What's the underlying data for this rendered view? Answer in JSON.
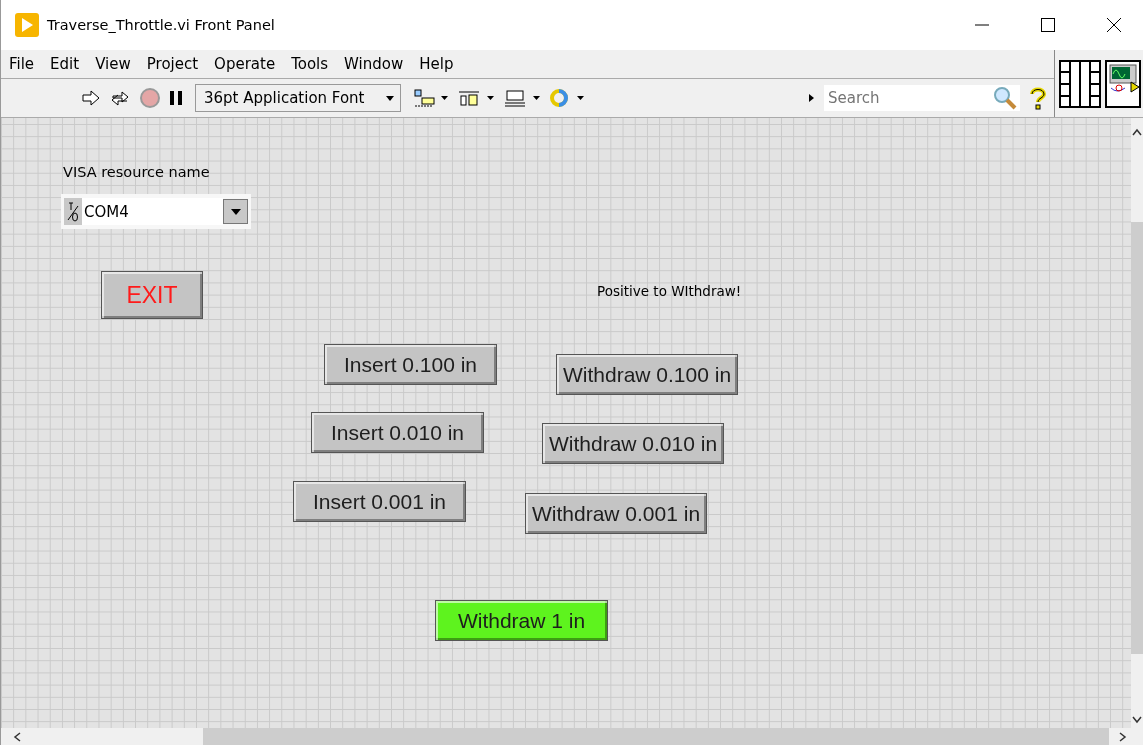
{
  "window": {
    "title": "Traverse_Throttle.vi Front Panel"
  },
  "menu": [
    "File",
    "Edit",
    "View",
    "Project",
    "Operate",
    "Tools",
    "Window",
    "Help"
  ],
  "toolbar": {
    "font": "36pt Application Font",
    "search": {
      "placeholder": "Search"
    }
  },
  "panel": {
    "visa": {
      "label": "VISA resource name",
      "value": "COM4"
    },
    "note": "Positive to WIthdraw!",
    "buttons": [
      {
        "label": "EXIT",
        "color": "#c4c4c4",
        "kind": "exit"
      },
      {
        "label": "Insert 0.100 in",
        "color": "#c4c4c4",
        "kind": "move"
      },
      {
        "label": "Withdraw 0.100 in",
        "color": "#c4c4c4",
        "kind": "move"
      },
      {
        "label": "Insert 0.010 in",
        "color": "#c4c4c4",
        "kind": "move"
      },
      {
        "label": "Withdraw 0.010 in",
        "color": "#c4c4c4",
        "kind": "move"
      },
      {
        "label": "Insert 0.001 in",
        "color": "#c4c4c4",
        "kind": "move"
      },
      {
        "label": "Withdraw 0.001 in",
        "color": "#c4c4c4",
        "kind": "move"
      },
      {
        "label": "Withdraw 1 in",
        "color": "#5ef31e",
        "kind": "move"
      }
    ]
  }
}
